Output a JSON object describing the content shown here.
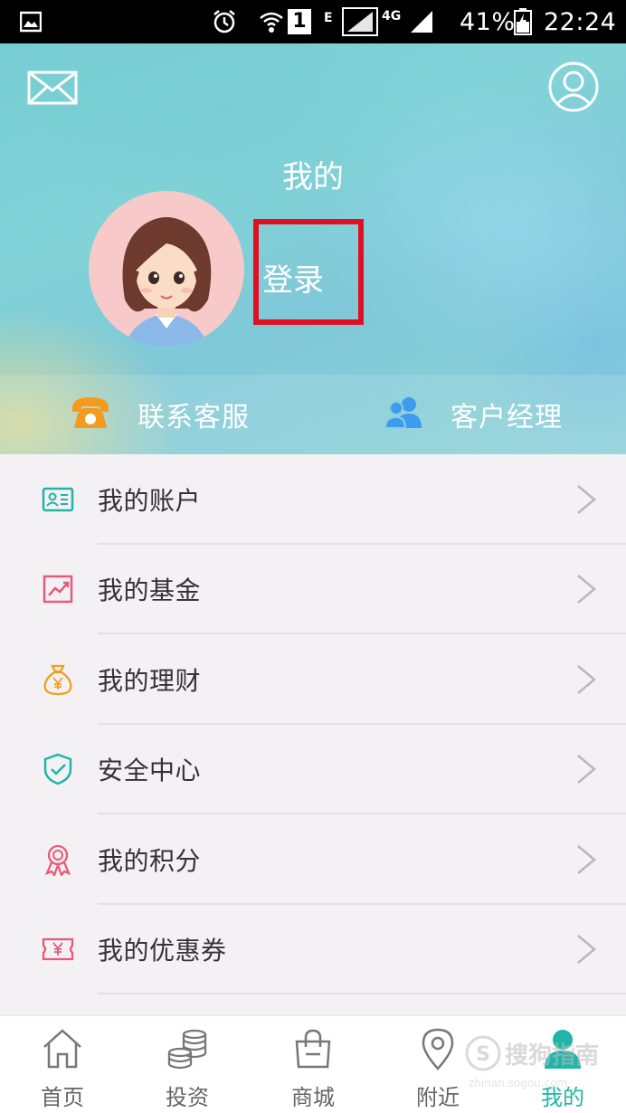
{
  "status_bar": {
    "network_type": "E",
    "network_type_2": "4G",
    "sim_badge": "1",
    "battery_percent": "41%",
    "time": "22:24"
  },
  "header": {
    "title": "我的",
    "login_label": "登录",
    "contact_service_label": "联系客服",
    "account_manager_label": "客户经理",
    "highlight_color": "#e01020"
  },
  "menu": {
    "items": [
      {
        "label": "我的账户",
        "icon": "id-card-icon",
        "color": "#1fb5a8"
      },
      {
        "label": "我的基金",
        "icon": "chart-trend-icon",
        "color": "#e85a7a"
      },
      {
        "label": "我的理财",
        "icon": "money-bag-icon",
        "color": "#f0a020"
      },
      {
        "label": "安全中心",
        "icon": "shield-check-icon",
        "color": "#1fb5a8"
      },
      {
        "label": "我的积分",
        "icon": "award-ribbon-icon",
        "color": "#e85a7a"
      },
      {
        "label": "我的优惠券",
        "icon": "coupon-icon",
        "color": "#e85a7a"
      }
    ]
  },
  "bottom_nav": {
    "items": [
      {
        "label": "首页",
        "icon": "home-icon"
      },
      {
        "label": "投资",
        "icon": "coins-icon"
      },
      {
        "label": "商城",
        "icon": "shopping-bag-icon"
      },
      {
        "label": "附近",
        "icon": "location-pin-icon"
      },
      {
        "label": "我的",
        "icon": "user-icon",
        "active": true
      }
    ],
    "active_color": "#1fb5a8"
  },
  "watermark": {
    "text": "搜狗指南",
    "url": "zhinan.sogou.com"
  }
}
